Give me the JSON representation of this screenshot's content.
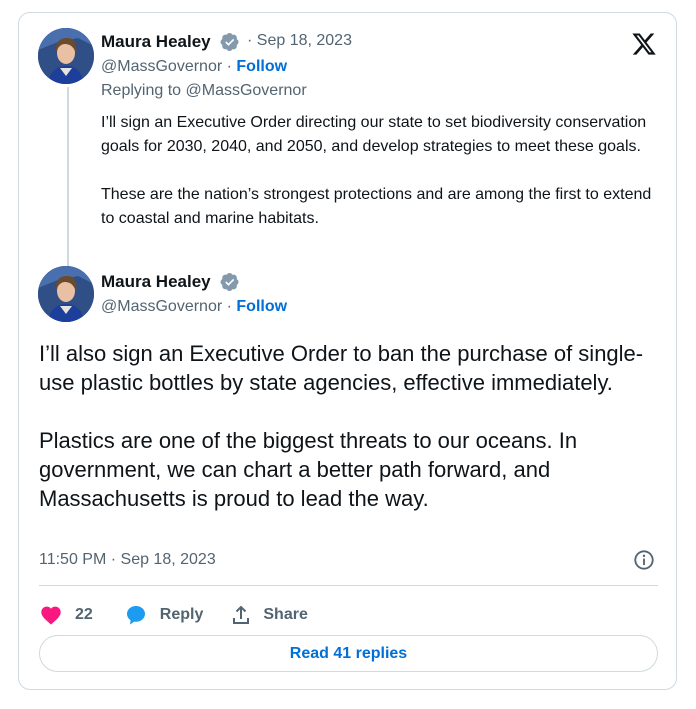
{
  "reply_tweet": {
    "author_name": "Maura Healey",
    "date": "Sep 18, 2023",
    "handle": "@MassGovernor",
    "follow_label": "Follow",
    "replying_to": "Replying to @MassGovernor",
    "paragraphs": [
      "I’ll sign an Executive Order directing our state to set biodiversity conservation goals for 2030, 2040, and 2050, and develop strategies to meet these goals.",
      "These are the nation’s strongest protections and are among the first to extend to coastal and marine habitats."
    ]
  },
  "main_tweet": {
    "author_name": "Maura Healey",
    "handle": "@MassGovernor",
    "follow_label": "Follow",
    "paragraphs": [
      "I’ll also sign an Executive Order to ban the purchase of single-use plastic bottles by state agencies, effective immediately.",
      "Plastics are one of the biggest threats to our oceans. In government, we can chart a better path forward, and Massachusetts is proud to lead the way."
    ],
    "timestamp": "11:50 PM · Sep 18, 2023"
  },
  "actions": {
    "like_count": "22",
    "reply_label": "Reply",
    "share_label": "Share"
  },
  "read_replies_label": "Read 41 replies",
  "colors": {
    "link_blue": "#006fd6",
    "like_pink": "#f91880",
    "verified_gray": "#829aab",
    "muted_text": "#536471",
    "border": "#cfd9de"
  },
  "icons": [
    "x-logo-icon",
    "verified-badge-icon",
    "info-icon",
    "heart-icon",
    "reply-bubble-icon",
    "share-icon"
  ]
}
